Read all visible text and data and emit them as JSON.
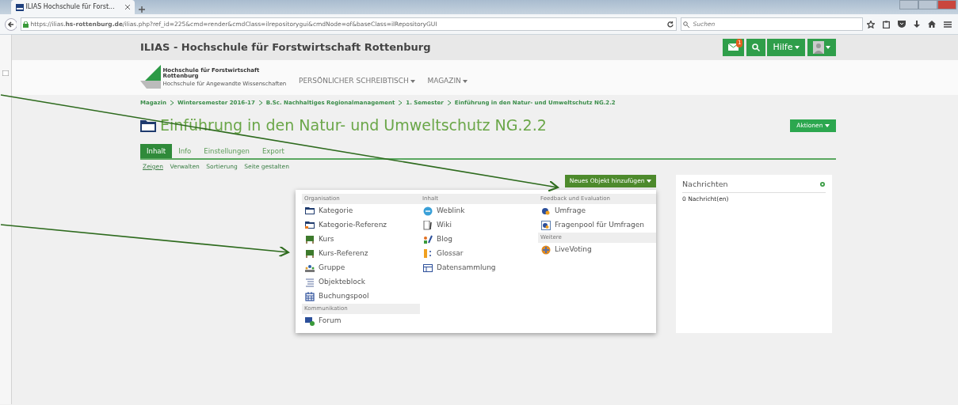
{
  "browser": {
    "tab_title": "ILIAS Hochschule für Forst...",
    "url": "https://ilias.**hs-rottenburg.de**/ilias.php?ref_id=225&cmd=render&cmdClass=ilrepositorygui&cmdNode=of&baseClass=ilRepositoryGUI",
    "search": {
      "placeholder": "Suchen"
    }
  },
  "header": {
    "title": "ILIAS - Hochschule für Forstwirtschaft Rottenburg",
    "mail_badge": "1",
    "help": "Hilfe"
  },
  "logo": {
    "name_line_1": "Hochschule für Forstwirtschaft",
    "name_line_2": "Rottenburg",
    "subtitle": "Hochschule für Angewandte Wissenschaften"
  },
  "main_menu": [
    "PERSÖNLICHER SCHREIBTISCH",
    "MAGAZIN"
  ],
  "breadcrumb": [
    "Magazin",
    "Wintersemester 2016-17",
    "B.Sc. Nachhaltiges Regionalmanagement",
    "1. Semester",
    "Einführung in den Natur- und Umweltschutz NG.2.2"
  ],
  "page_title": "Einführung in den Natur- und Umweltschutz NG.2.2",
  "actions_button": "Aktionen",
  "tabs": [
    {
      "label": "Inhalt",
      "selected": true
    },
    {
      "label": "Info",
      "selected": false
    },
    {
      "label": "Einstellungen",
      "selected": false
    },
    {
      "label": "Export",
      "selected": false
    }
  ],
  "subtabs": [
    {
      "label": "Zeigen",
      "selected": true
    },
    {
      "label": "Verwalten",
      "selected": false
    },
    {
      "label": "Sortierung",
      "selected": false
    },
    {
      "label": "Seite gestalten",
      "selected": false
    }
  ],
  "add_button": "Neues Objekt hinzufügen",
  "add_menu": [
    [
      {
        "heading": "Organisation",
        "items": [
          {
            "label": "Kategorie",
            "kind": "folder"
          },
          {
            "label": "Kategorie-Referenz",
            "kind": "folderref"
          },
          {
            "label": "Kurs",
            "kind": "course"
          },
          {
            "label": "Kurs-Referenz",
            "kind": "course"
          },
          {
            "label": "Gruppe",
            "kind": "group"
          },
          {
            "label": "Objekteblock",
            "kind": "list"
          },
          {
            "label": "Buchungspool",
            "kind": "calendar"
          }
        ]
      },
      {
        "heading": "Kommunikation",
        "items": [
          {
            "label": "Forum",
            "kind": "forum"
          }
        ]
      }
    ],
    [
      {
        "heading": "Inhalt",
        "items": [
          {
            "label": "Weblink",
            "kind": "globe"
          },
          {
            "label": "Wiki",
            "kind": "wiki"
          },
          {
            "label": "Blog",
            "kind": "blog"
          },
          {
            "label": "Glossar",
            "kind": "glossary"
          },
          {
            "label": "Datensammlung",
            "kind": "table"
          }
        ]
      }
    ],
    [
      {
        "heading": "Feedback und Evaluation",
        "items": [
          {
            "label": "Umfrage",
            "kind": "survey"
          },
          {
            "label": "Fragenpool für Umfragen",
            "kind": "pool"
          }
        ]
      },
      {
        "heading": "Weitere",
        "items": [
          {
            "label": "LiveVoting",
            "kind": "voting"
          }
        ]
      }
    ]
  ],
  "news": {
    "title": "Nachrichten",
    "text": "0 Nachricht(en)"
  }
}
